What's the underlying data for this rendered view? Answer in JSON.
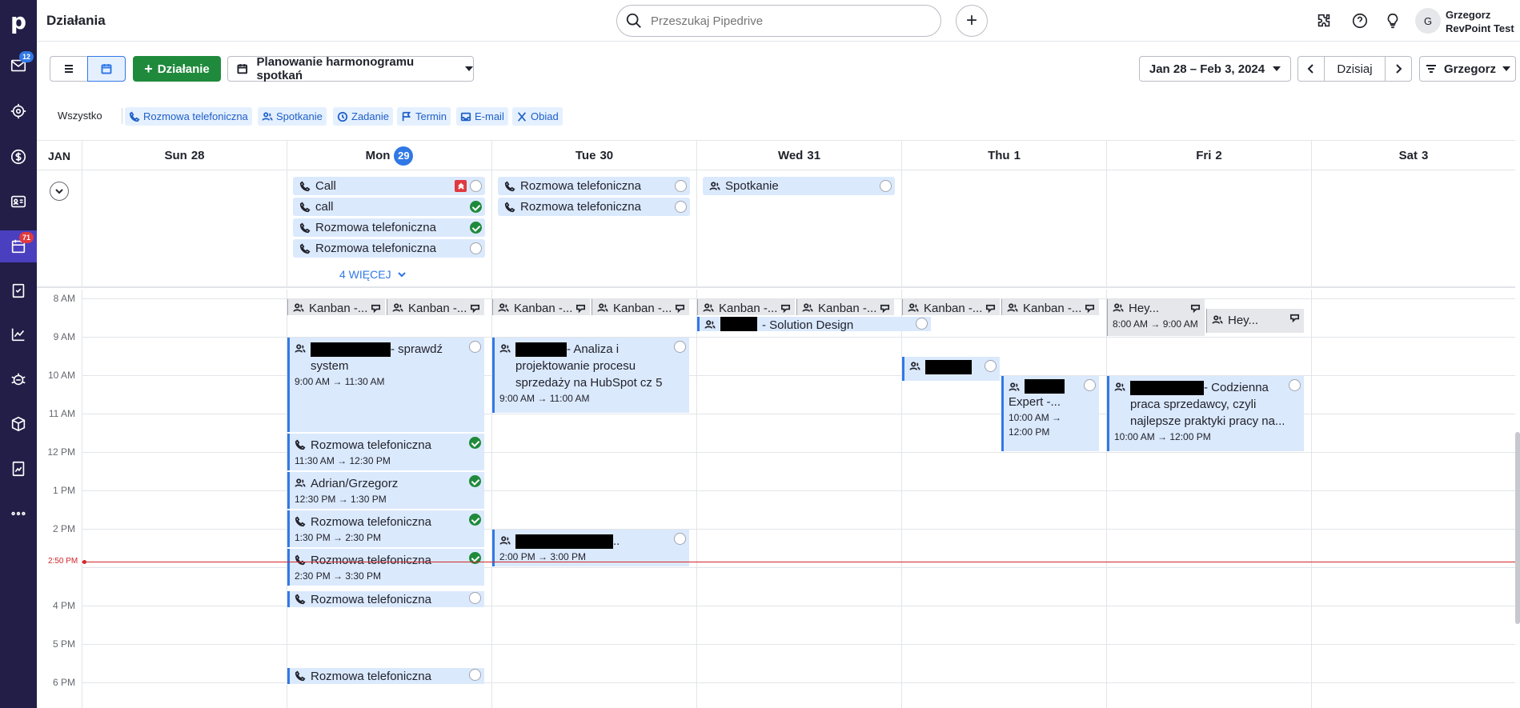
{
  "app": {
    "title": "Działania"
  },
  "nav": {
    "logo": "p",
    "mail_badge": "12",
    "activities_badge": "71",
    "icons": [
      "mail-icon",
      "target-icon",
      "dollar-icon",
      "contacts-icon",
      "calendar-icon",
      "tasks-icon",
      "insights-icon",
      "bug-icon",
      "box-icon",
      "reports-icon",
      "more-icon"
    ]
  },
  "search": {
    "placeholder": "Przeszukaj Pipedrive"
  },
  "user": {
    "initial": "G",
    "name": "Grzegorz",
    "company": "RevPoint Test"
  },
  "toolbar": {
    "add_activity": "Działanie",
    "scheduler": "Planowanie harmonogramu spotkań",
    "date_range": "Jan 28 – Feb 3, 2024",
    "today": "Dzisiaj",
    "owner": "Grzegorz"
  },
  "filters": {
    "all": "Wszystko",
    "chips": [
      "Rozmowa telefoniczna",
      "Spotkanie",
      "Zadanie",
      "Termin",
      "E-mail",
      "Obiad"
    ]
  },
  "calendar": {
    "month": "JAN",
    "days": [
      {
        "name": "Sun",
        "num": "28"
      },
      {
        "name": "Mon",
        "num": "29"
      },
      {
        "name": "Tue",
        "num": "30"
      },
      {
        "name": "Wed",
        "num": "31"
      },
      {
        "name": "Thu",
        "num": "1"
      },
      {
        "name": "Fri",
        "num": "2"
      },
      {
        "name": "Sat",
        "num": "3"
      }
    ],
    "allday": {
      "mon": [
        "Call",
        "call",
        "Rozmowa telefoniczna",
        "Rozmowa telefoniczna"
      ],
      "tue": [
        "Rozmowa telefoniczna",
        "Rozmowa telefoniczna"
      ],
      "wed": [
        "Spotkanie"
      ],
      "more": "4 WIĘCEJ"
    },
    "hours": [
      "8 AM",
      "9 AM",
      "10 AM",
      "11 AM",
      "12 PM",
      "1 PM",
      "2 PM",
      "3 PM",
      "4 PM",
      "5 PM",
      "6 PM"
    ],
    "now": "2:50 PM",
    "events": {
      "kanban": "Kanban -...",
      "hey": "Hey...",
      "hey_time": "8:00 AM → 9:00 AM",
      "solution_design": "- Solution Design",
      "sprawdz": "- sprawdź system",
      "sprawdz_time": "9:00 AM → 11:30 AM",
      "analiza": "- Analiza i projektowanie procesu sprzedaży na HubSpot cz 5",
      "analiza_time": "9:00 AM → 11:00 AM",
      "thu_short": "-...",
      "expert": "Expert -...",
      "expert_time": "10:00 AM → 12:00 PM",
      "codzienna": "- Codzienna praca sprzedawcy, czyli najlepsze praktyki pracy na...",
      "codzienna_time": "10:00 AM → 12:00 PM",
      "call1": "Rozmowa telefoniczna",
      "call1_time": "11:30 AM → 12:30 PM",
      "adrian": "Adrian/Grzegorz",
      "adrian_time": "12:30 PM → 1:30 PM",
      "call2": "Rozmowa telefoniczna",
      "call2_time": "1:30 PM → 2:30 PM",
      "call3": "Rozmowa telefoniczna",
      "call3_time": "2:30 PM → 3:30 PM",
      "tue_ellipsis": "..",
      "tue_time": "2:00 PM → 3:00 PM",
      "call4": "Rozmowa telefoniczna",
      "call5": "Rozmowa telefoniczna"
    }
  }
}
